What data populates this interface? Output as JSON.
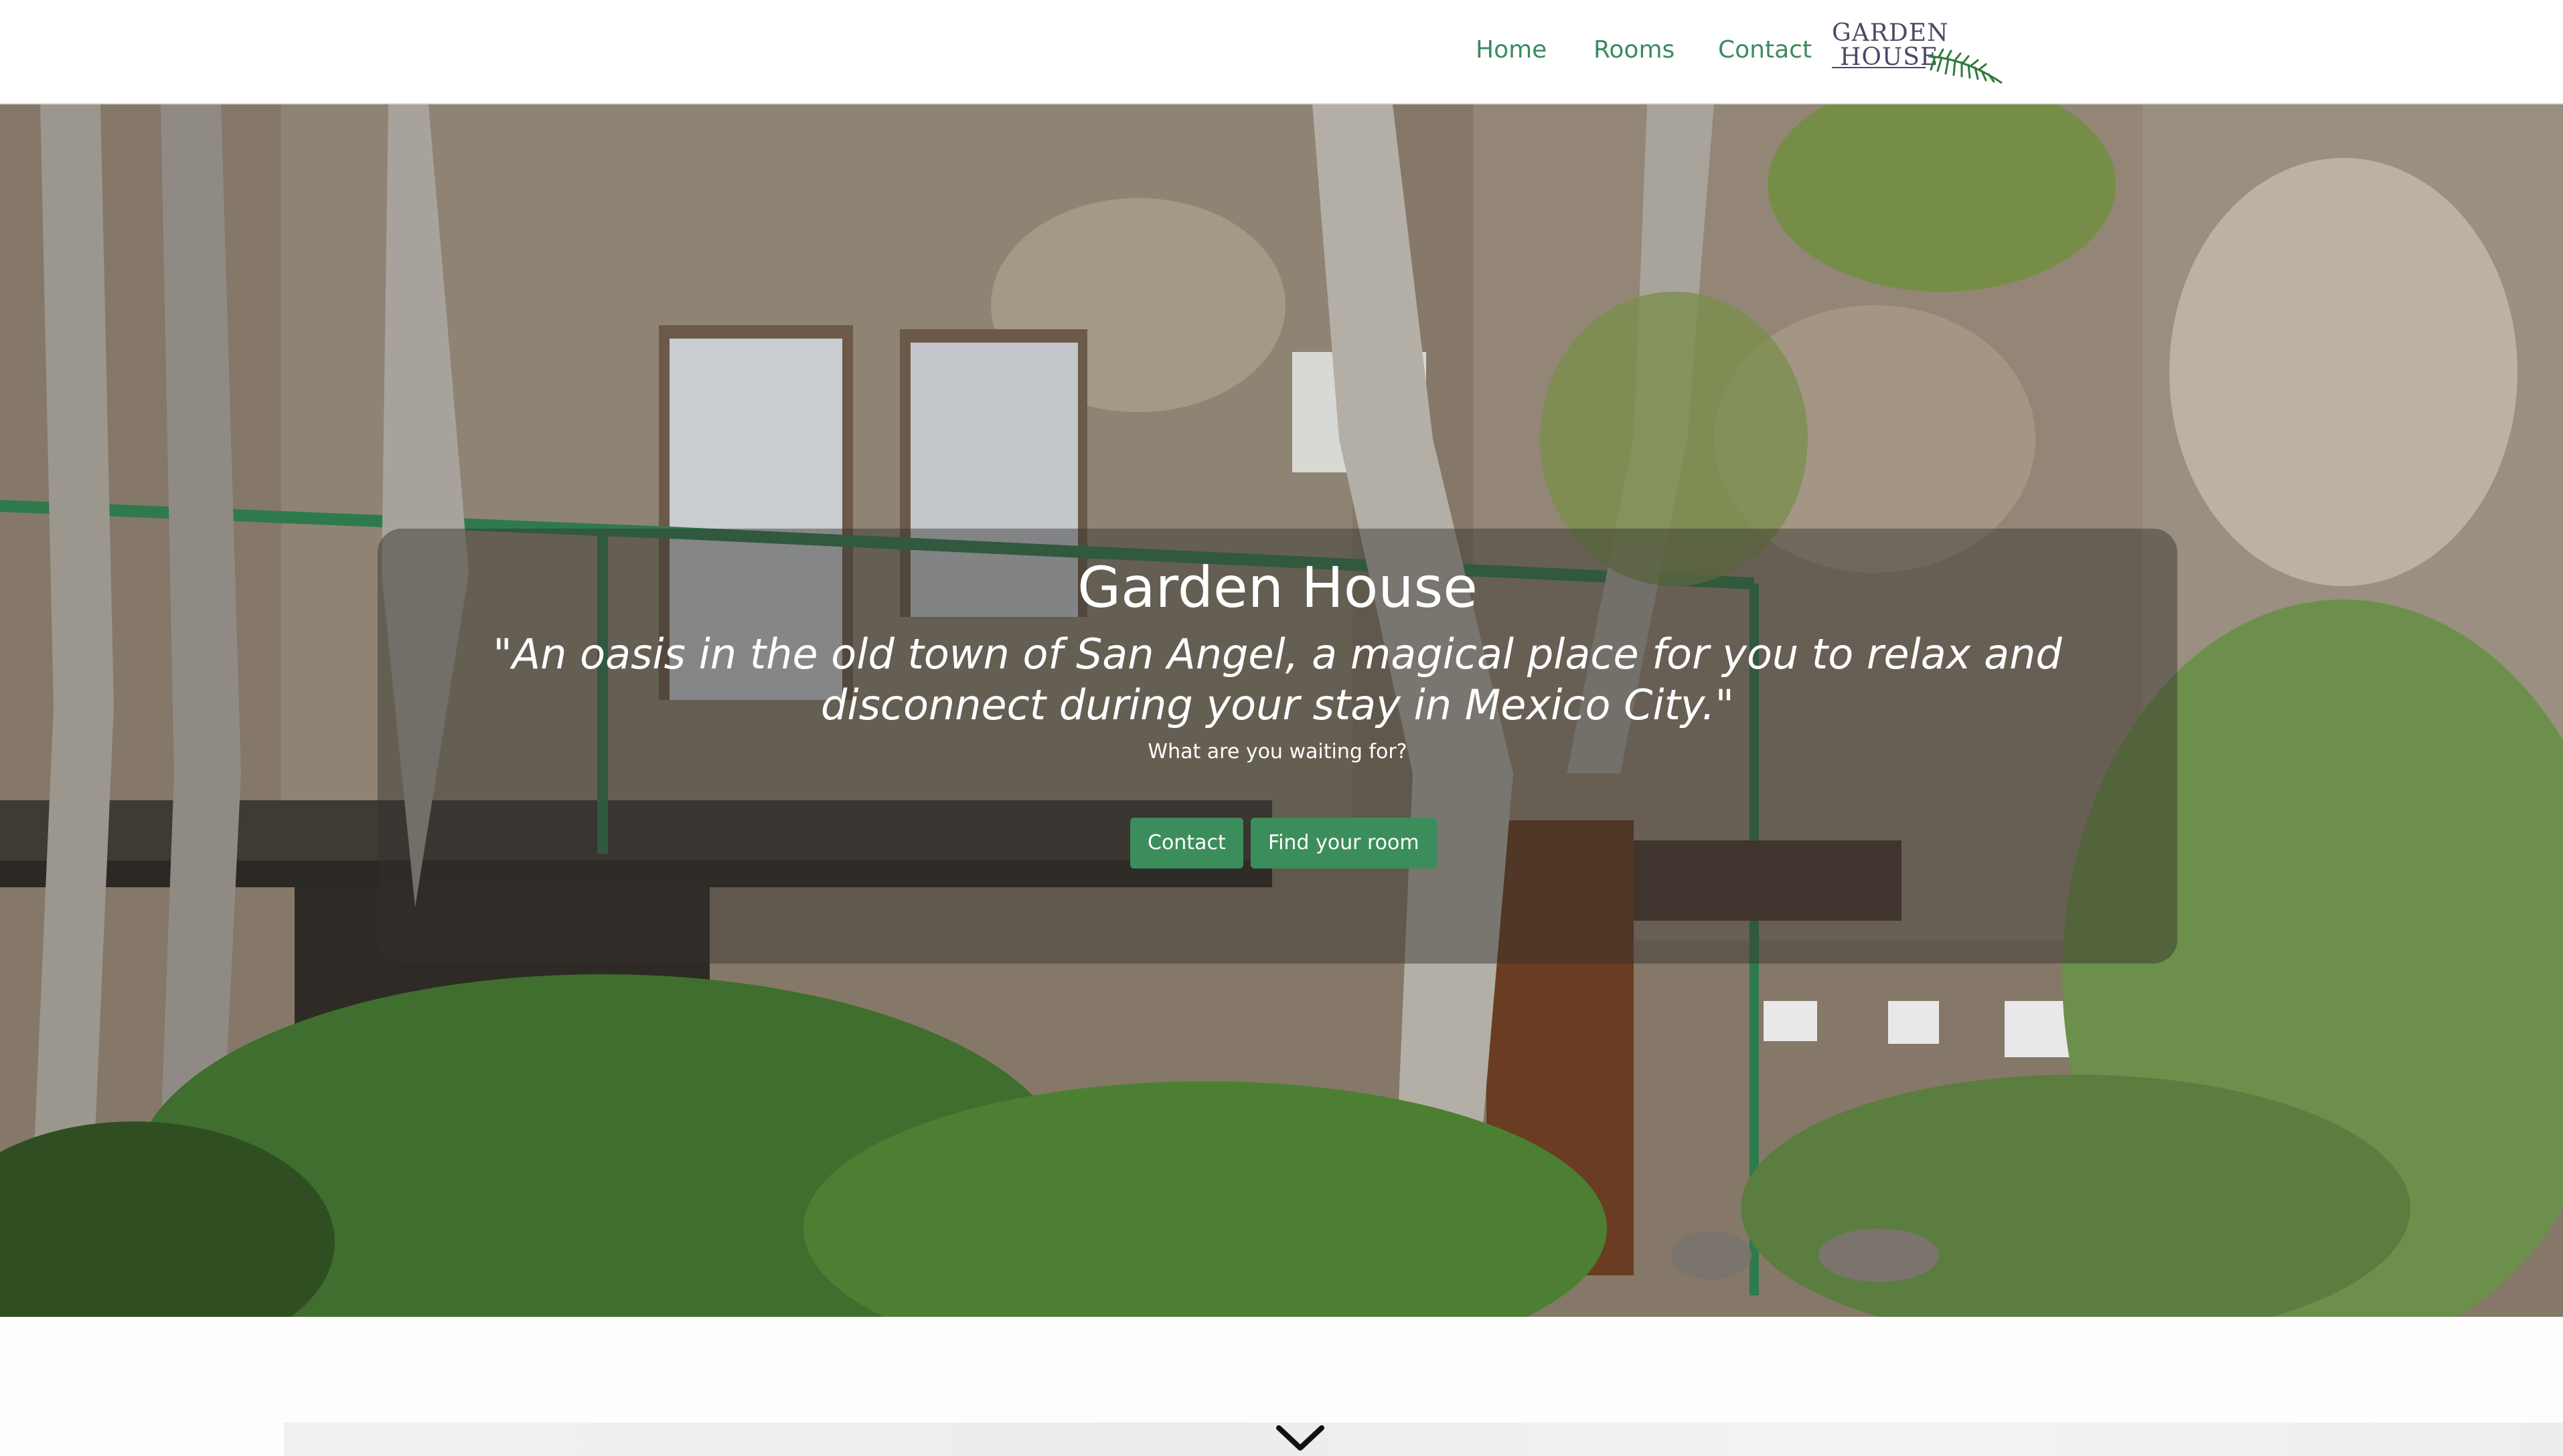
{
  "nav": {
    "links": [
      "Home",
      "Rooms",
      "Contact"
    ],
    "logo_line1": "GARDEN",
    "logo_line2": "HOUSE"
  },
  "hero": {
    "title": "Garden House",
    "quote": "\"An oasis in the old town of San Angel, a magical place for you to relax and disconnect during your stay in Mexico City.\"",
    "question": "What are you waiting for?",
    "buttons": [
      "Contact",
      "Find your room"
    ]
  },
  "colors": {
    "accent": "#3c8d5c",
    "nav_link": "#3b8a5f",
    "logo_text": "#4a4a66",
    "logo_leaf": "#2e7a3a"
  },
  "icons": {
    "scroll": "chevron-down-icon",
    "logo": "fern-leaf-icon"
  }
}
